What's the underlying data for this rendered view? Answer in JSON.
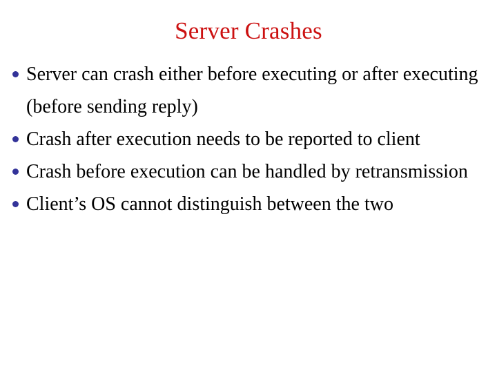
{
  "slide": {
    "title": "Server Crashes",
    "title_color": "#cc1111",
    "background_color": "#ffffff",
    "body_text_color": "#000000",
    "bullet_color": "#333399",
    "bullets": [
      {
        "text": "Server can crash either before executing or after executing (before sending reply)"
      },
      {
        "text": "Crash after execution needs to be reported to client"
      },
      {
        "text": "Crash before execution can be handled by retransmission"
      },
      {
        "text": "Client’s OS cannot distinguish between the two"
      }
    ]
  }
}
